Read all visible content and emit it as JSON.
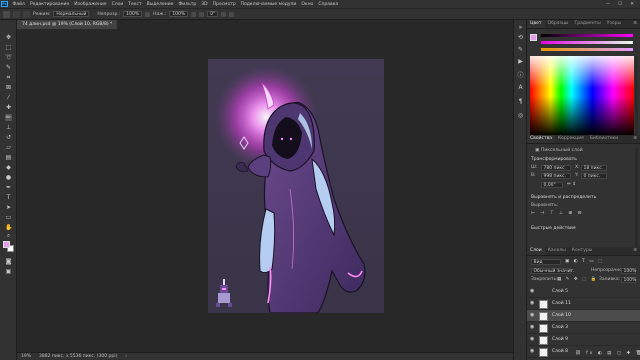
{
  "menubar": {
    "logo": "Ps",
    "items": [
      "Файл",
      "Редактирование",
      "Изображение",
      "Слои",
      "Текст",
      "Выделение",
      "Фильтр",
      "3D",
      "Просмотр",
      "Подключаемые модули",
      "Окно",
      "Справка"
    ],
    "window_controls": [
      "—",
      "☐",
      "✕"
    ]
  },
  "options": {
    "mode_label": "Режим:",
    "mode_value": "Нормальный",
    "opacity_label": "Непрозр.:",
    "opacity_value": "100%",
    "flow_label": "Наж.:",
    "flow_value": "100%",
    "angle_value": "0°"
  },
  "document": {
    "tab_title": "74 длин.psd @ 19% (Слой 10, RGB/8) *"
  },
  "status": {
    "zoom": "19%",
    "dimensions": "3882 пикс. x 5536 пикс. (300 ppi)"
  },
  "colors": {
    "foreground": "#e59be9",
    "background": "#ffffff",
    "glow": "#ff6bff",
    "figure": "#5a3a7a"
  },
  "panels": {
    "top_tabs": [
      "Цвет",
      "Образцы",
      "Градиенты",
      "Узоры"
    ],
    "mid_tabs": [
      "Свойства",
      "Коррекция",
      "Библиотеки"
    ],
    "properties": {
      "layer_type": "Пиксельный слой",
      "transform_title": "Трансформировать",
      "w_value": "780 пикс.",
      "h_value": "998 пикс.",
      "x_value": "18 пикс.",
      "y_value": "0 пикс.",
      "angle_value": "0,00°",
      "align_title": "Выровнять и распределить",
      "align_label": "Выровнять:",
      "quick_title": "Быстрые действия"
    },
    "layers": {
      "tabs": [
        "Слои",
        "Каналы",
        "Контуры"
      ],
      "filter_label": "Вид",
      "blend_mode": "Обычный значит.",
      "opacity_label": "Непрозрачность:",
      "opacity_value": "100%",
      "lock_label": "Закрепить:",
      "fill_label": "Заливка:",
      "fill_value": "100%",
      "items": [
        {
          "name": "Слой 5"
        },
        {
          "name": "Слой 11"
        },
        {
          "name": "Слой 10"
        },
        {
          "name": "Слой 3"
        },
        {
          "name": "Слой 9"
        },
        {
          "name": "Слой 8"
        }
      ],
      "selected": 2
    }
  }
}
